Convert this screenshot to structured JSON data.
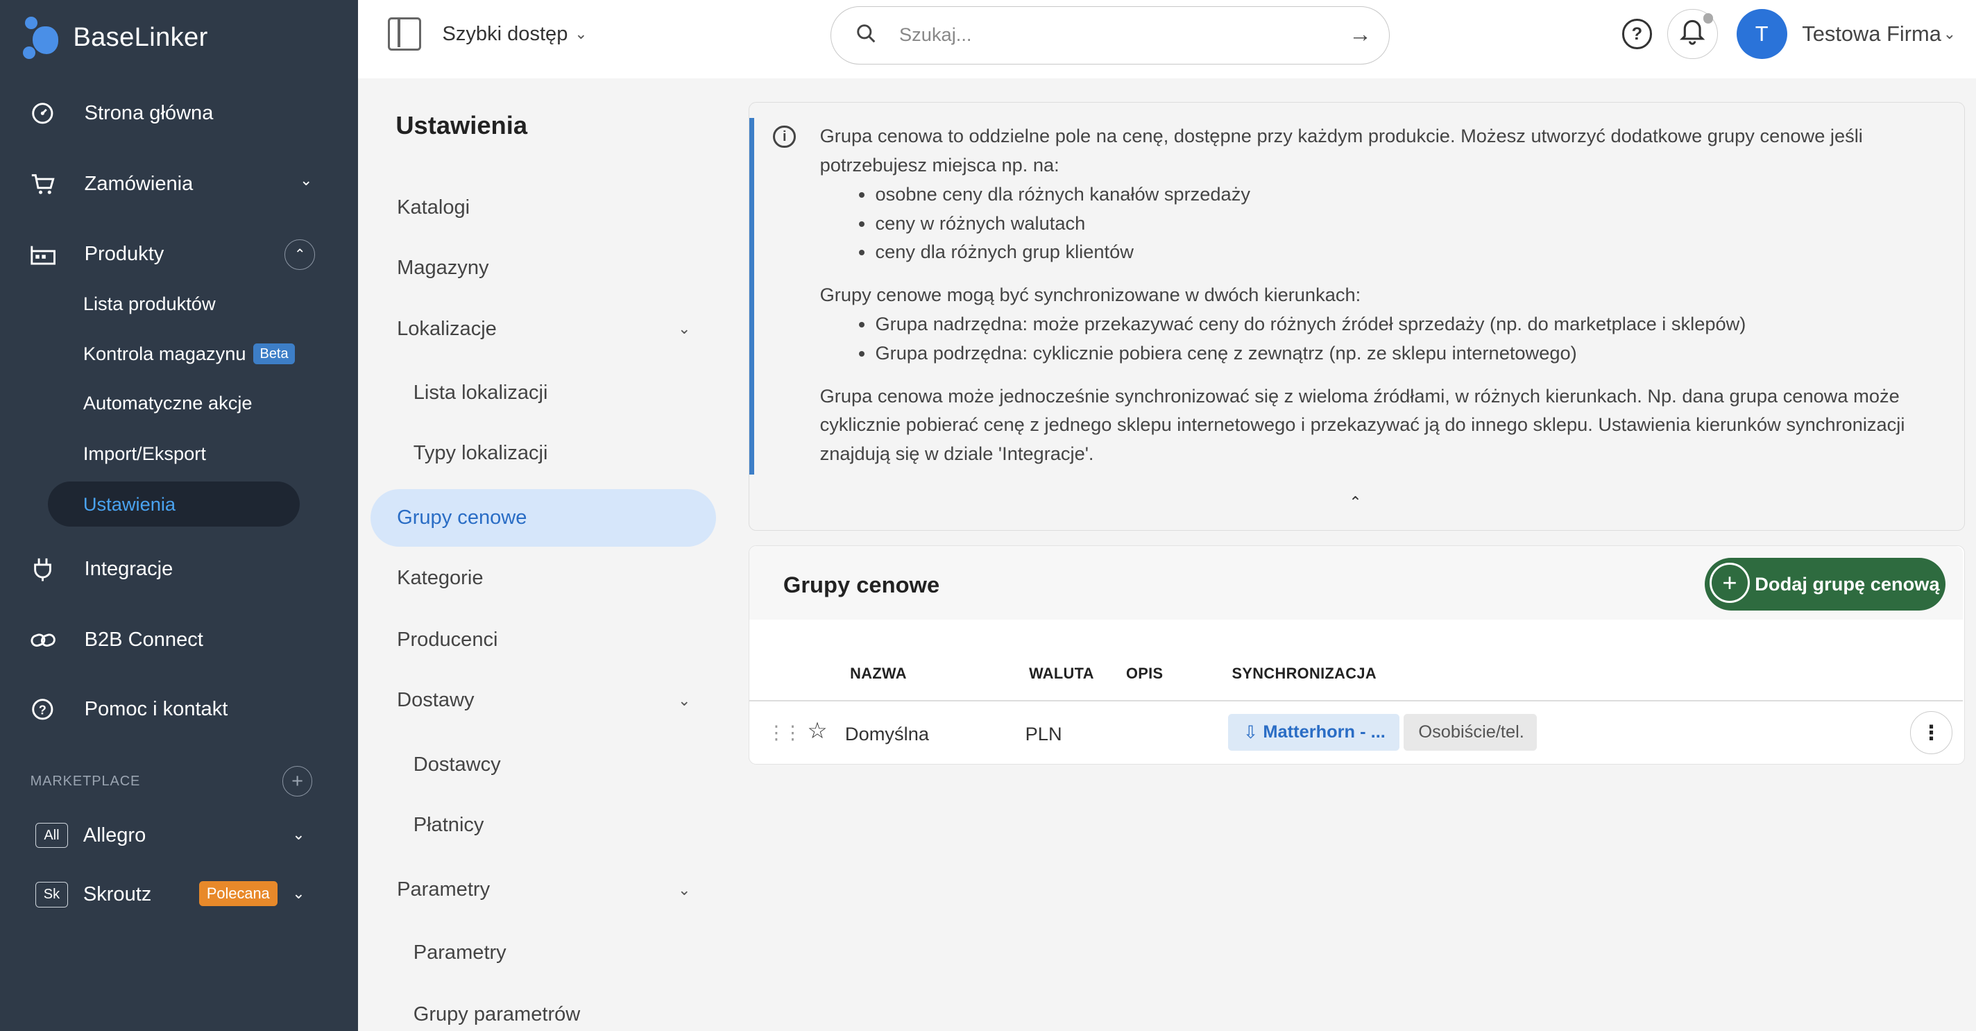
{
  "brand": {
    "name": "BaseLinker"
  },
  "sidebar": {
    "items": [
      {
        "label": "Strona główna"
      },
      {
        "label": "Zamówienia"
      },
      {
        "label": "Produkty"
      },
      {
        "label": "Integracje"
      },
      {
        "label": "B2B Connect"
      },
      {
        "label": "Pomoc i kontakt"
      }
    ],
    "products_sub": [
      {
        "label": "Lista produktów"
      },
      {
        "label": "Kontrola magazynu",
        "badge": "Beta"
      },
      {
        "label": "Automatyczne akcje"
      },
      {
        "label": "Import/Eksport"
      },
      {
        "label": "Ustawienia"
      }
    ],
    "marketplace_label": "MARKETPLACE",
    "marketplaces": [
      {
        "box": "All",
        "label": "Allegro"
      },
      {
        "box": "Sk",
        "label": "Skroutz",
        "badge": "Polecana"
      }
    ]
  },
  "topbar": {
    "quick_access": "Szybki dostęp",
    "search_placeholder": "Szukaj...",
    "help": "?",
    "avatar_initial": "T",
    "company": "Testowa Firma"
  },
  "settings": {
    "title": "Ustawienia",
    "items": [
      {
        "label": "Katalogi"
      },
      {
        "label": "Magazyny"
      },
      {
        "label": "Lokalizacje"
      },
      {
        "label": "Lista lokalizacji"
      },
      {
        "label": "Typy lokalizacji"
      },
      {
        "label": "Grupy cenowe"
      },
      {
        "label": "Kategorie"
      },
      {
        "label": "Producenci"
      },
      {
        "label": "Dostawy"
      },
      {
        "label": "Dostawcy"
      },
      {
        "label": "Płatnicy"
      },
      {
        "label": "Parametry"
      },
      {
        "label": "Parametry"
      },
      {
        "label": "Grupy parametrów"
      }
    ]
  },
  "info": {
    "p1": "Grupa cenowa to oddzielne pole na cenę, dostępne przy każdym produkcie. Możesz utworzyć dodatkowe grupy cenowe jeśli potrzebujesz miejsca np. na:",
    "list1": [
      "osobne ceny dla różnych kanałów sprzedaży",
      "ceny w różnych walutach",
      "ceny dla różnych grup klientów"
    ],
    "p2": "Grupy cenowe mogą być synchronizowane w dwóch kierunkach:",
    "list2": [
      "Grupa nadrzędna: może przekazywać ceny do różnych źródeł sprzedaży (np. do marketplace i sklepów)",
      "Grupa podrzędna: cyklicznie pobiera cenę z zewnątrz (np. ze sklepu internetowego)"
    ],
    "p3": "Grupa cenowa może jednocześnie synchronizować się z wieloma źródłami, w różnych kierunkach. Np. dana grupa cenowa może cyklicznie pobierać cenę z jednego sklepu internetowego i przekazywać ją do innego sklepu. Ustawienia kierunków synchronizacji znajdują się w dziale 'Integracje'."
  },
  "groups": {
    "title": "Grupy cenowe",
    "add_label": "Dodaj grupę cenową",
    "columns": [
      "NAZWA",
      "WALUTA",
      "OPIS",
      "SYNCHRONIZACJA"
    ],
    "rows": [
      {
        "name": "Domyślna",
        "currency": "PLN",
        "description": "",
        "sync": "Matterhorn - ...",
        "sync2": "Osobiście/tel."
      }
    ]
  },
  "colors": {
    "sidebar_bg": "#2f3a48",
    "accent": "#2a73d9",
    "add_button": "#2e6b3f",
    "active_nav": "#d6e6fa"
  }
}
